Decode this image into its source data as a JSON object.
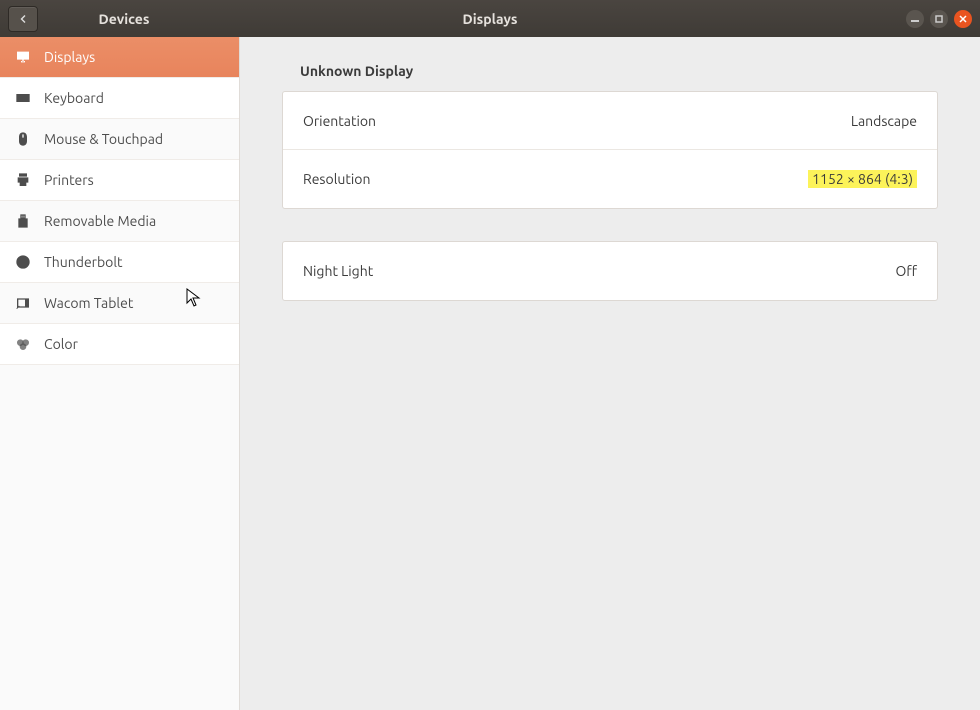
{
  "titlebar": {
    "left_title": "Devices",
    "center_title": "Displays"
  },
  "sidebar": {
    "items": [
      {
        "label": "Displays",
        "icon": "display-icon",
        "selected": true
      },
      {
        "label": "Keyboard",
        "icon": "keyboard-icon",
        "selected": false
      },
      {
        "label": "Mouse & Touchpad",
        "icon": "mouse-icon",
        "selected": false
      },
      {
        "label": "Printers",
        "icon": "printer-icon",
        "selected": false
      },
      {
        "label": "Removable Media",
        "icon": "usb-icon",
        "selected": false
      },
      {
        "label": "Thunderbolt",
        "icon": "thunderbolt-icon",
        "selected": false
      },
      {
        "label": "Wacom Tablet",
        "icon": "tablet-icon",
        "selected": false
      },
      {
        "label": "Color",
        "icon": "color-icon",
        "selected": false
      }
    ]
  },
  "main": {
    "section_title": "Unknown Display",
    "rows": [
      {
        "label": "Orientation",
        "value": "Landscape",
        "highlight": false
      },
      {
        "label": "Resolution",
        "value": "1152 × 864 (4:3)",
        "highlight": true
      }
    ],
    "night_light": {
      "label": "Night Light",
      "value": "Off"
    }
  }
}
